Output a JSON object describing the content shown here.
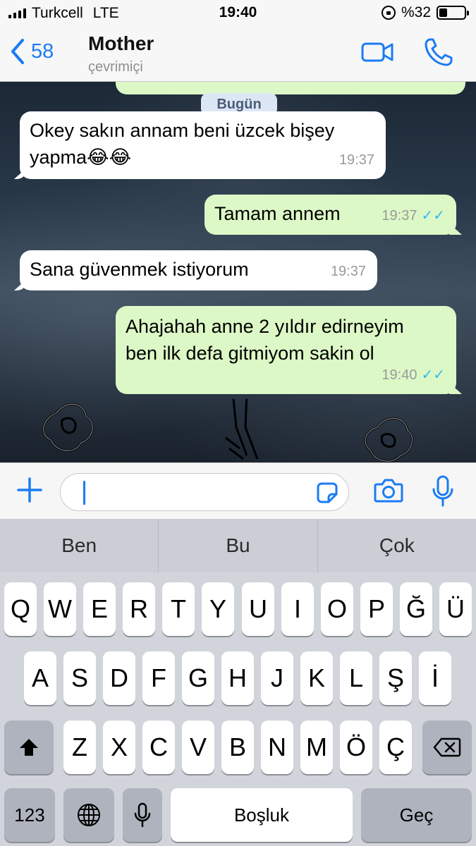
{
  "status_bar": {
    "carrier": "Turkcell",
    "network": "LTE",
    "time": "19:40",
    "battery_percent": "%32",
    "battery_level": 0.32
  },
  "header": {
    "back_count": "58",
    "contact_name": "Mother",
    "contact_status": "çevrimiçi"
  },
  "chat": {
    "date_chip": "Bugün",
    "messages": [
      {
        "direction": "incoming",
        "text_line1": "Okey sakın annam beni üzcek bişey",
        "text_line2": "yapma😂😂",
        "time": "19:37"
      },
      {
        "direction": "outgoing",
        "text": "Tamam annem",
        "time": "19:37",
        "ticks": "✓✓"
      },
      {
        "direction": "incoming",
        "text": "Sana güvenmek istiyorum",
        "time": "19:37"
      },
      {
        "direction": "outgoing",
        "text_line1": "Ahajahah anne 2 yıldır edirneyim",
        "text_line2": "ben ilk defa gitmiyom sakin ol",
        "time": "19:40",
        "ticks": "✓✓"
      }
    ]
  },
  "input": {
    "icons": [
      "plus-icon",
      "sticker-icon",
      "camera-icon",
      "microphone-icon"
    ]
  },
  "predictions": [
    "Ben",
    "Bu",
    "Çok"
  ],
  "keyboard": {
    "row1": [
      "Q",
      "W",
      "E",
      "R",
      "T",
      "Y",
      "U",
      "I",
      "O",
      "P",
      "Ğ",
      "Ü"
    ],
    "row2": [
      "A",
      "S",
      "D",
      "F",
      "G",
      "H",
      "J",
      "K",
      "L",
      "Ş",
      "İ"
    ],
    "row3": [
      "Z",
      "X",
      "C",
      "V",
      "B",
      "N",
      "M",
      "Ö",
      "Ç"
    ],
    "numbers_key": "123",
    "space_key": "Boşluk",
    "return_key": "Geç"
  },
  "colors": {
    "accent": "#1a7cf5",
    "outgoing_bubble": "#dcf8c6",
    "read_ticks": "#34b7f1"
  }
}
